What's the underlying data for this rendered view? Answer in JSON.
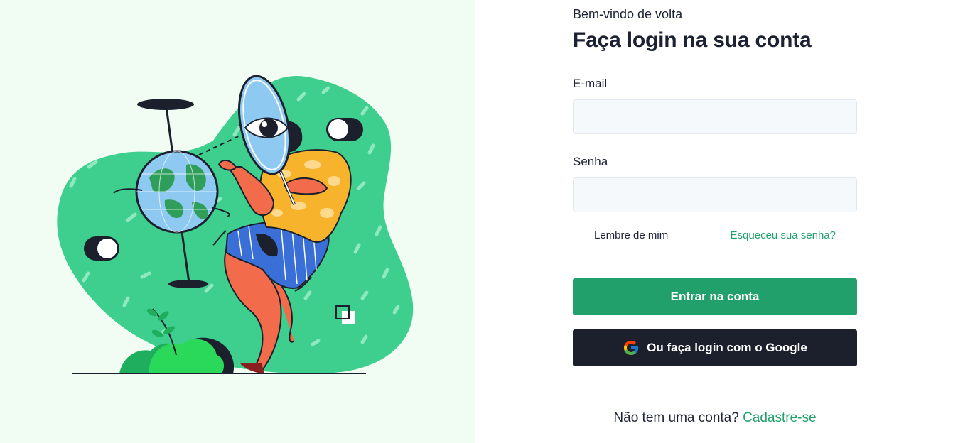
{
  "login": {
    "welcome": "Bem-vindo de volta",
    "title": "Faça login na sua conta",
    "email_label": "E-mail",
    "email_value": "",
    "password_label": "Senha",
    "password_value": "",
    "remember_label": "Lembre de mim",
    "remember_checked": false,
    "forgot_link": "Esqueceu sua senha?",
    "submit_label": "Entrar na conta",
    "google_label": "Ou faça login com o Google",
    "signup_prompt": "Não tem uma conta?",
    "signup_link": "Cadastre-se"
  },
  "icons": {
    "google": "google-g-icon"
  },
  "colors": {
    "accent": "#22a06b",
    "link": "#21a06c",
    "dark_button": "#1b202c",
    "left_panel_bg": "#f1fdf3",
    "input_bg": "#f6f9fc"
  }
}
